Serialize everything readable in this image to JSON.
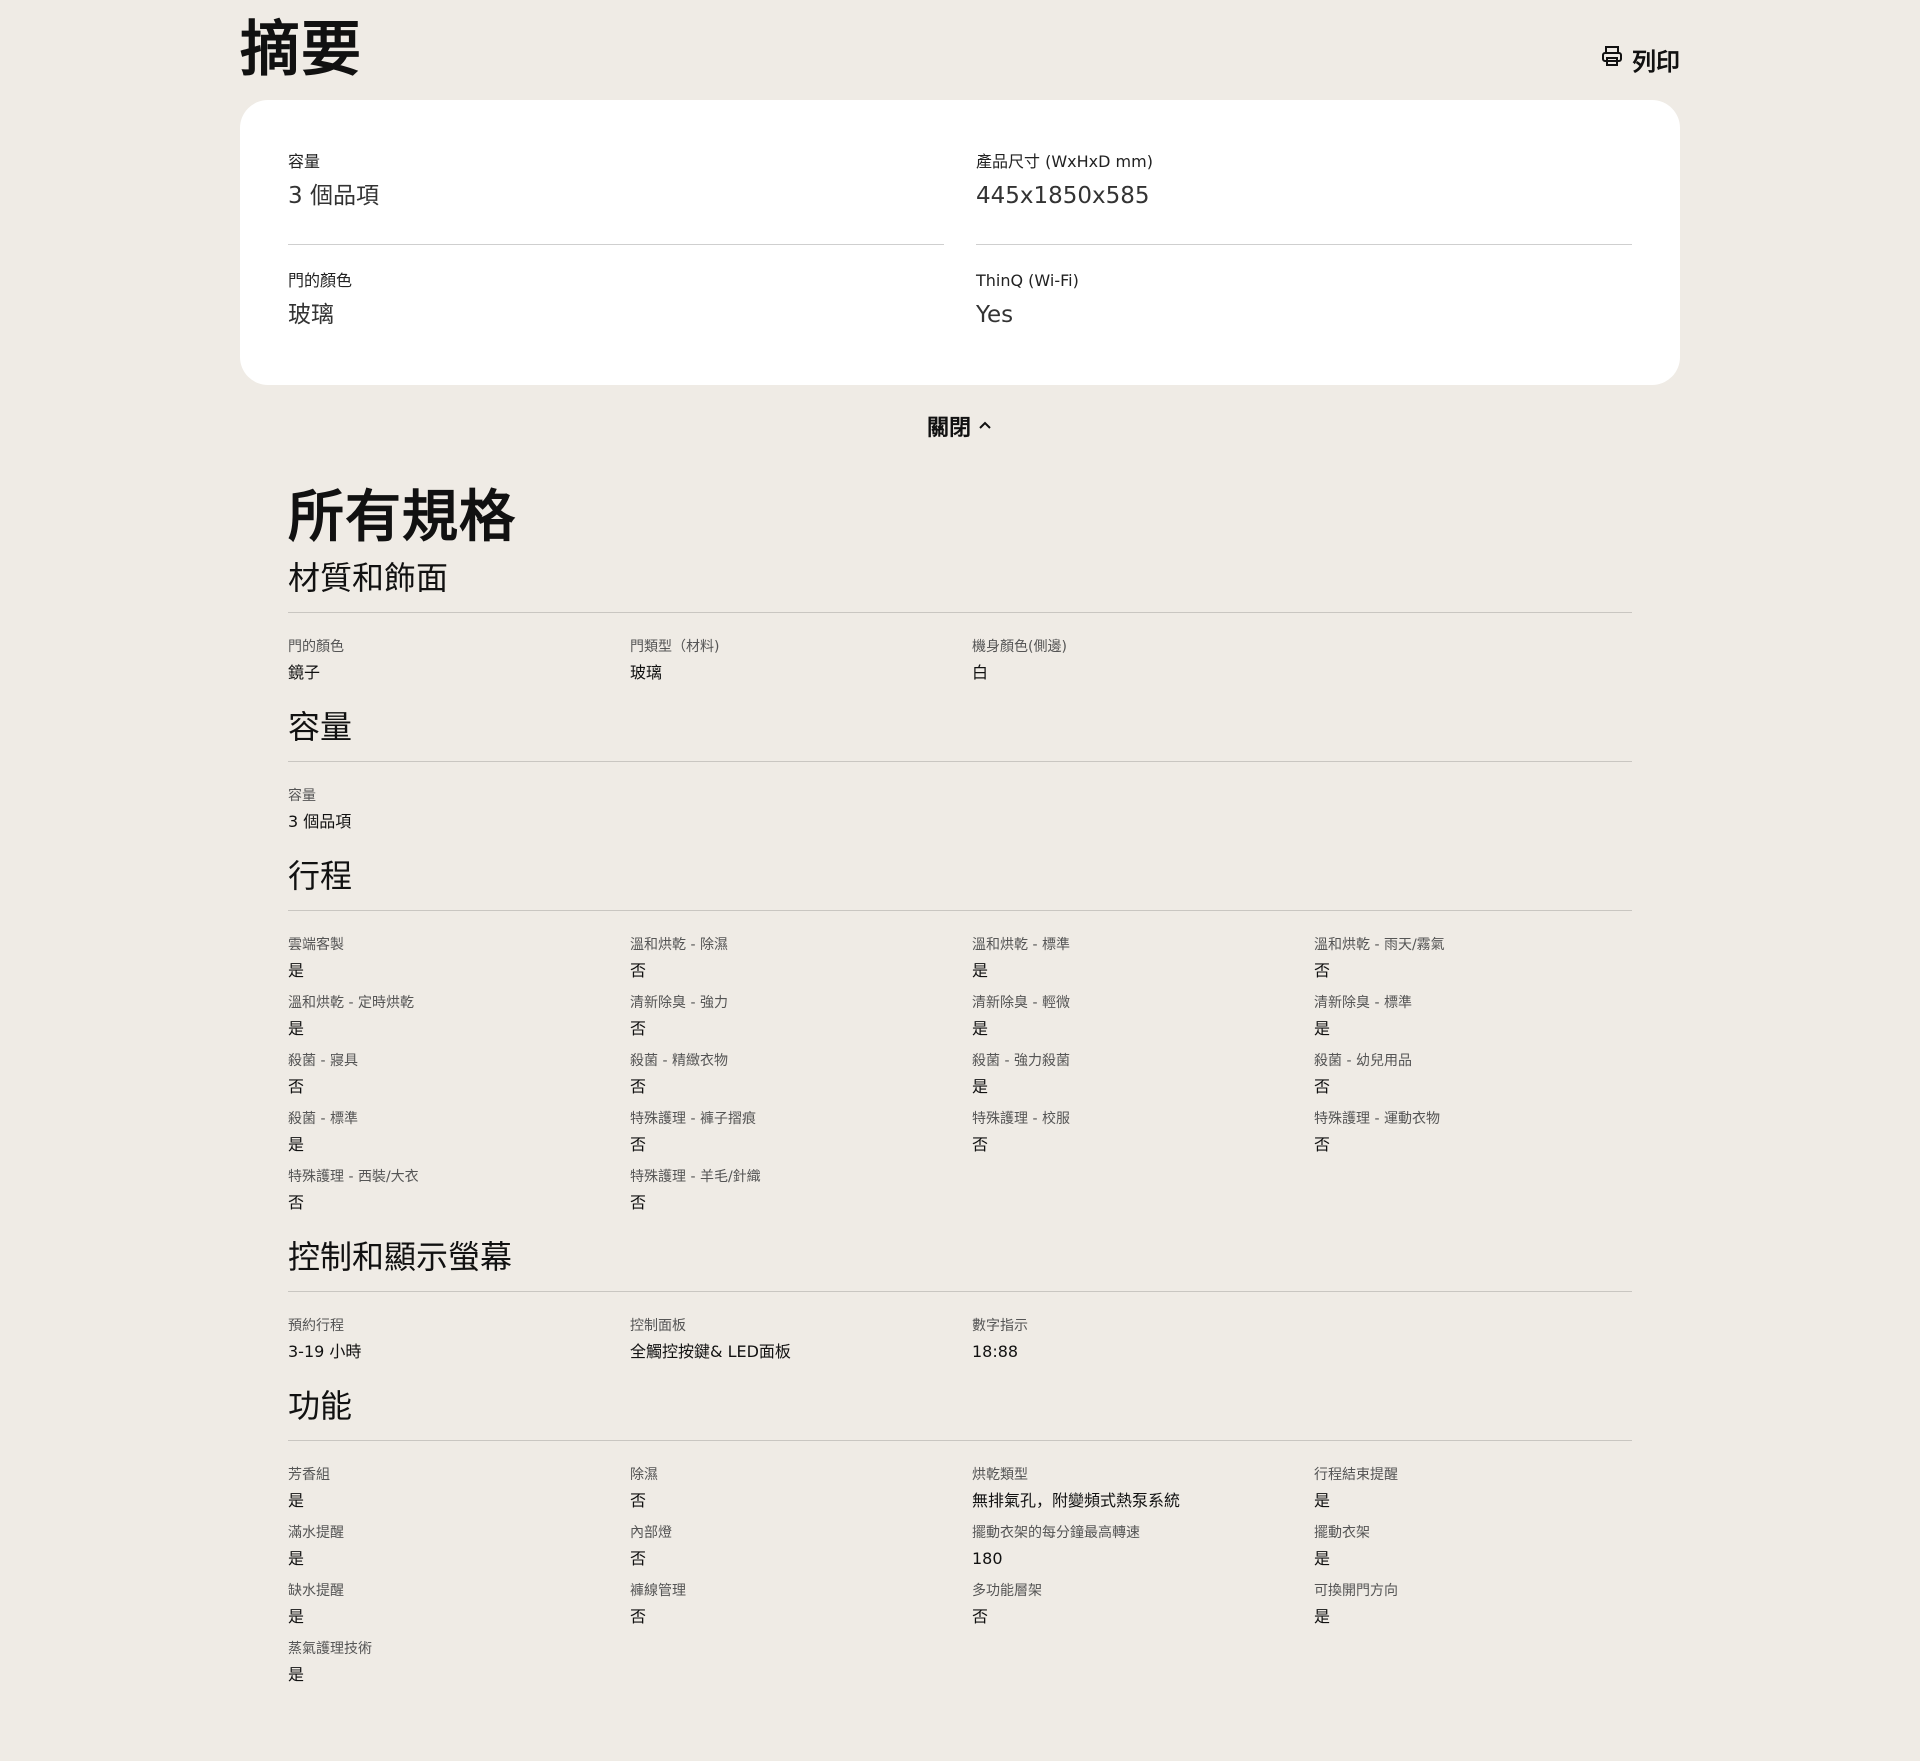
{
  "summary": {
    "title": "摘要",
    "print_label": "列印",
    "items": [
      {
        "label": "容量",
        "value": "3 個品項"
      },
      {
        "label": "產品尺寸 (WxHxD mm)",
        "value": "445x1850x585"
      },
      {
        "label": "門的顏色",
        "value": "玻璃"
      },
      {
        "label": "ThinQ (Wi-Fi)",
        "value": "Yes"
      }
    ],
    "close_label": "關閉"
  },
  "specs": {
    "title": "所有規格",
    "sections": [
      {
        "title": "材質和飾面",
        "items": [
          {
            "k": "門的顏色",
            "v": "鏡子"
          },
          {
            "k": "門類型（材料)",
            "v": "玻璃"
          },
          {
            "k": "機身顏色(側邊)",
            "v": "白"
          }
        ]
      },
      {
        "title": "容量",
        "items": [
          {
            "k": "容量",
            "v": "3 個品項"
          }
        ]
      },
      {
        "title": "行程",
        "items": [
          {
            "k": "雲端客製",
            "v": "是"
          },
          {
            "k": "溫和烘乾 - 除濕",
            "v": "否"
          },
          {
            "k": "溫和烘乾 - 標準",
            "v": "是"
          },
          {
            "k": "溫和烘乾 - 雨天/霧氣",
            "v": "否"
          },
          {
            "k": "溫和烘乾 - 定時烘乾",
            "v": "是"
          },
          {
            "k": "清新除臭 - 強力",
            "v": "否"
          },
          {
            "k": "清新除臭 - 輕微",
            "v": "是"
          },
          {
            "k": "清新除臭 - 標準",
            "v": "是"
          },
          {
            "k": "殺菌 - 寢具",
            "v": "否"
          },
          {
            "k": "殺菌 - 精緻衣物",
            "v": "否"
          },
          {
            "k": "殺菌 - 強力殺菌",
            "v": "是"
          },
          {
            "k": "殺菌 - 幼兒用品",
            "v": "否"
          },
          {
            "k": "殺菌 - 標準",
            "v": "是"
          },
          {
            "k": "特殊護理 - 褲子摺痕",
            "v": "否"
          },
          {
            "k": "特殊護理 - 校服",
            "v": "否"
          },
          {
            "k": "特殊護理 - 運動衣物",
            "v": "否"
          },
          {
            "k": "特殊護理 - 西裝/大衣",
            "v": "否"
          },
          {
            "k": "特殊護理 - 羊毛/針織",
            "v": "否"
          }
        ]
      },
      {
        "title": "控制和顯示螢幕",
        "items": [
          {
            "k": "預約行程",
            "v": "3-19 小時"
          },
          {
            "k": "控制面板",
            "v": "全觸控按鍵& LED面板"
          },
          {
            "k": "數字指示",
            "v": "18:88"
          }
        ]
      },
      {
        "title": "功能",
        "items": [
          {
            "k": "芳香組",
            "v": "是"
          },
          {
            "k": "除濕",
            "v": "否"
          },
          {
            "k": "烘乾類型",
            "v": "無排氣孔，附變頻式熱泵系統"
          },
          {
            "k": "行程結束提醒",
            "v": "是"
          },
          {
            "k": "滿水提醒",
            "v": "是"
          },
          {
            "k": "內部燈",
            "v": "否"
          },
          {
            "k": "擺動衣架的每分鐘最高轉速",
            "v": "180"
          },
          {
            "k": "擺動衣架",
            "v": "是"
          },
          {
            "k": "缺水提醒",
            "v": "是"
          },
          {
            "k": "褲線管理",
            "v": "否"
          },
          {
            "k": "多功能層架",
            "v": "否"
          },
          {
            "k": "可換開門方向",
            "v": "是"
          },
          {
            "k": "蒸氣護理技術",
            "v": "是"
          }
        ]
      }
    ]
  }
}
